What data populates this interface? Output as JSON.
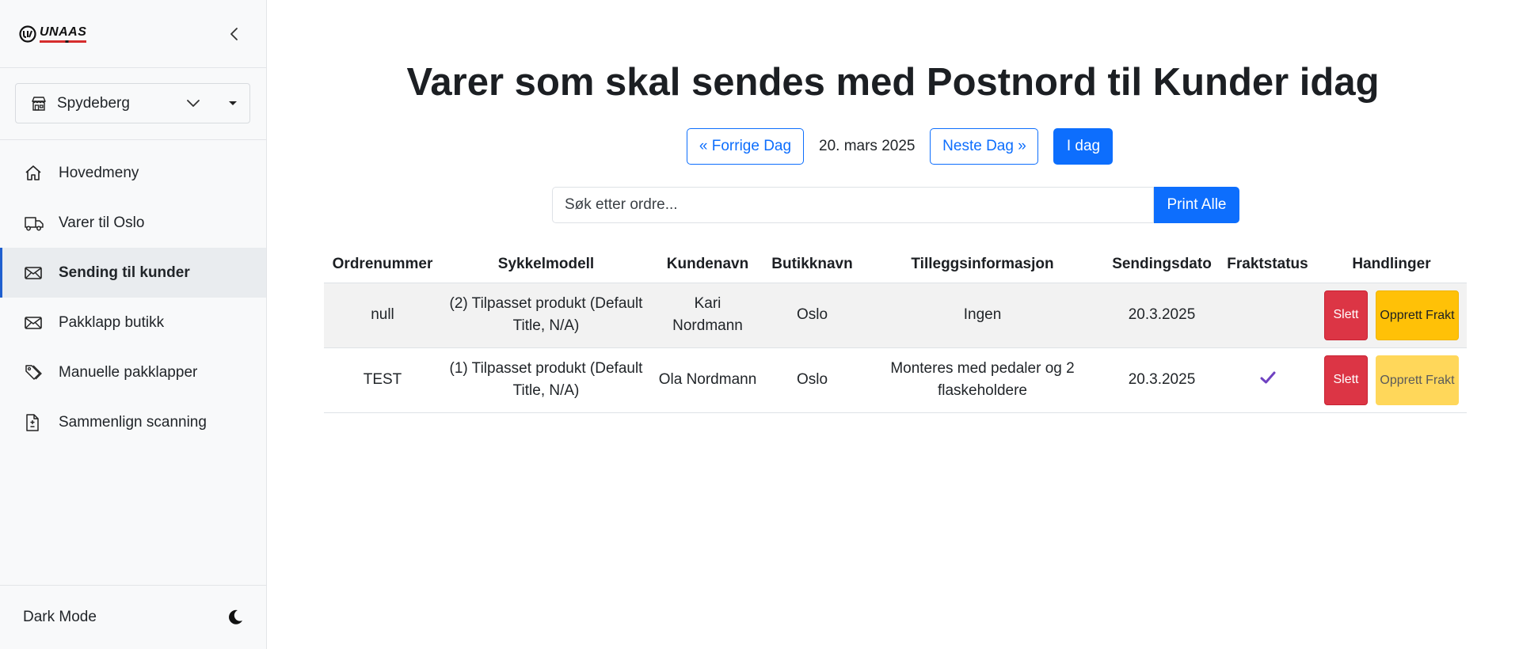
{
  "sidebar": {
    "logo_text": "UNAAS",
    "store": {
      "selected": "Spydeberg"
    },
    "items": [
      {
        "label": "Hovedmeny",
        "icon": "home-icon",
        "active": false
      },
      {
        "label": "Varer til Oslo",
        "icon": "truck-icon",
        "active": false
      },
      {
        "label": "Sending til kunder",
        "icon": "envelope-icon",
        "active": true
      },
      {
        "label": "Pakklapp butikk",
        "icon": "envelope-icon",
        "active": false
      },
      {
        "label": "Manuelle pakklapper",
        "icon": "tags-icon",
        "active": false
      },
      {
        "label": "Sammenlign scanning",
        "icon": "file-diff-icon",
        "active": false
      }
    ],
    "footer": {
      "dark_mode_label": "Dark Mode",
      "icon": "moon-icon"
    }
  },
  "main": {
    "title": "Varer som skal sendes med Postnord til Kunder idag",
    "date_nav": {
      "prev_label": "« Forrige Dag",
      "date": "20. mars 2025",
      "next_label": "Neste Dag »",
      "today_label": "I dag"
    },
    "search": {
      "placeholder": "Søk etter ordre...",
      "value": "",
      "print_all_label": "Print Alle"
    },
    "table": {
      "columns": [
        "Ordrenummer",
        "Sykkelmodell",
        "Kundenavn",
        "Butikknavn",
        "Tilleggsinformasjon",
        "Sendingsdato",
        "Fraktstatus",
        "Handlinger"
      ],
      "rows": [
        {
          "order": "null",
          "model": "(2) Tilpasset produkt (Default Title, N/A)",
          "customer": "Kari Nordmann",
          "store": "Oslo",
          "info": "Ingen",
          "date": "20.3.2025",
          "shipped": false,
          "delete_label": "Slett",
          "freight_label": "Opprett Frakt"
        },
        {
          "order": "TEST",
          "model": "(1) Tilpasset produkt (Default Title, N/A)",
          "customer": "Ola Nordmann",
          "store": "Oslo",
          "info": "Monteres med pedaler og 2 flaskeholdere",
          "date": "20.3.2025",
          "shipped": true,
          "delete_label": "Slett",
          "freight_label": "Opprett Frakt"
        }
      ]
    }
  },
  "colors": {
    "primary": "#0d6efd",
    "danger": "#dc3545",
    "warning": "#ffc107",
    "check": "#6f42c1"
  }
}
